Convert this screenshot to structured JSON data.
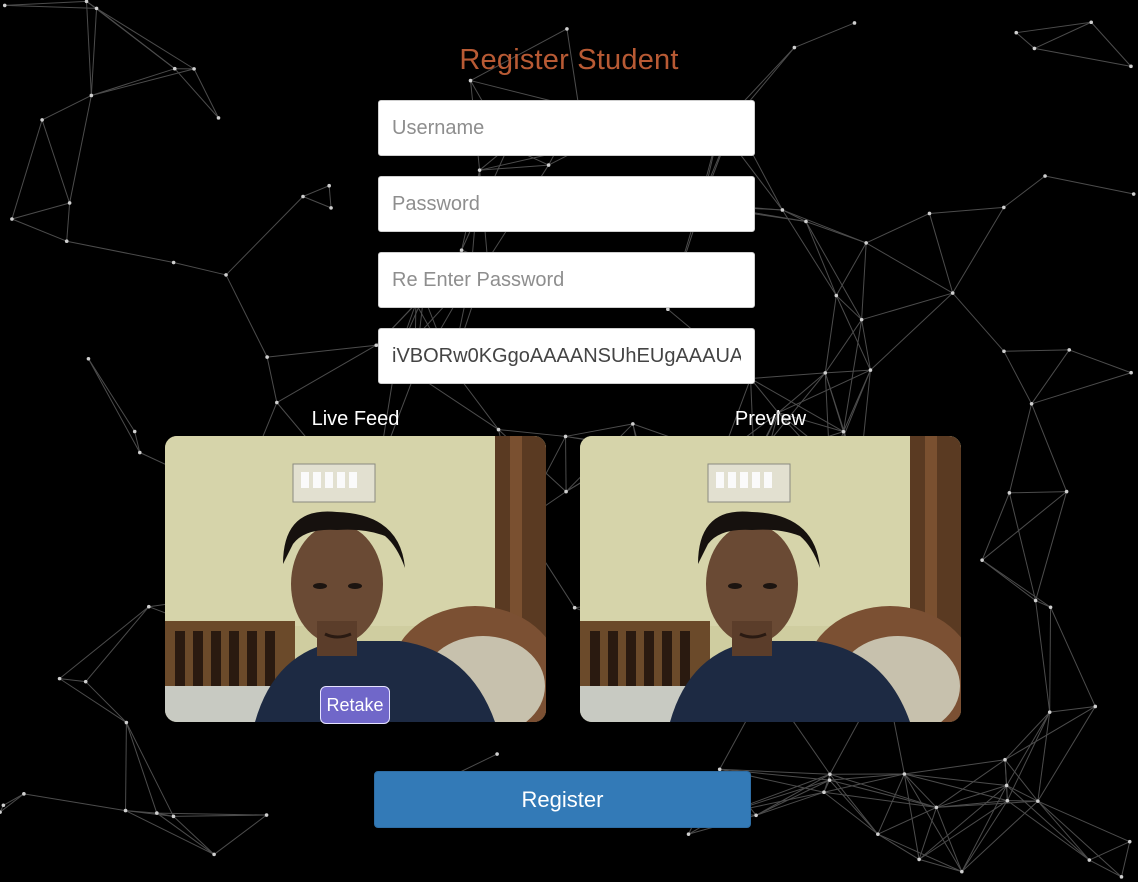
{
  "title": "Register Student",
  "form": {
    "username_placeholder": "Username",
    "password_placeholder": "Password",
    "reenter_password_placeholder": "Re Enter Password",
    "image_data_value": "iVBORw0KGgoAAAANSUhEUgAAAUA"
  },
  "camera": {
    "live_feed_label": "Live Feed",
    "preview_label": "Preview",
    "retake_label": "Retake"
  },
  "register_label": "Register",
  "colors": {
    "background": "#000000",
    "title": "#b85a34",
    "register_button": "#337ab7",
    "retake_button": "#7067c9"
  }
}
